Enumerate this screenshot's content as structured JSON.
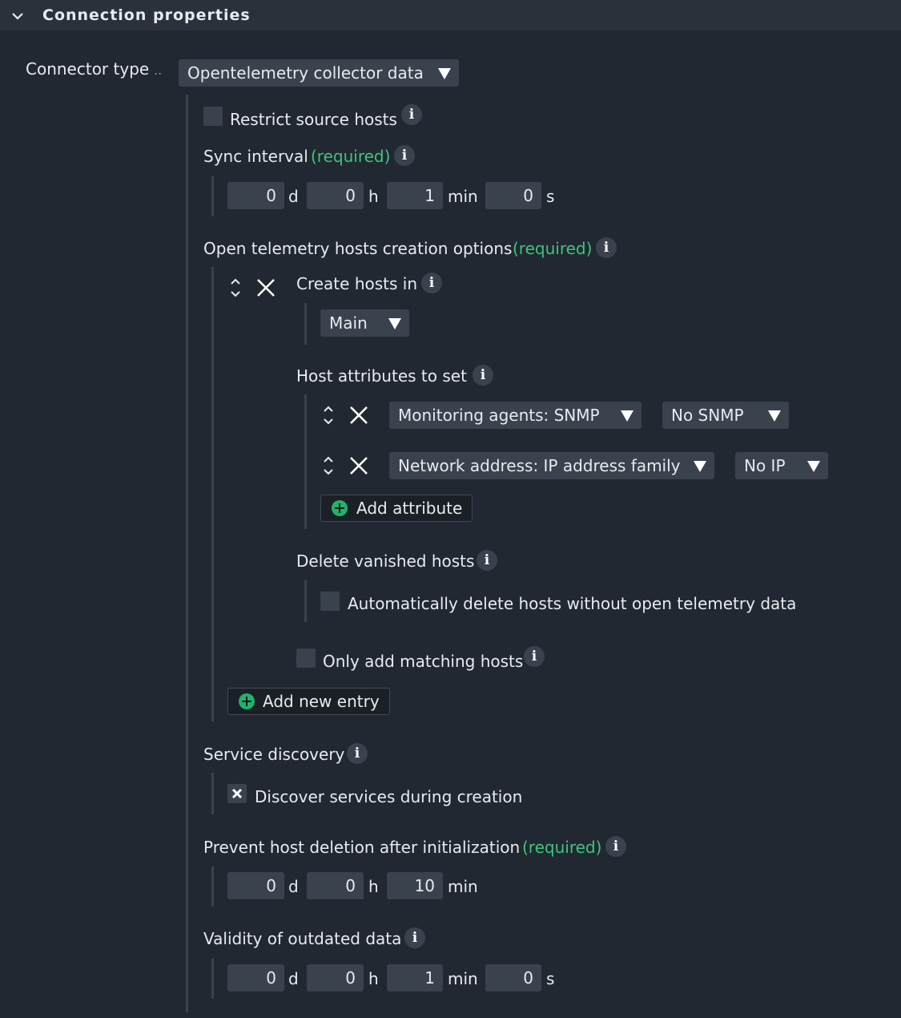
{
  "section": {
    "title": "Connection properties"
  },
  "connector": {
    "label": "Connector type",
    "dots": "..",
    "value": "Opentelemetry collector data"
  },
  "restrict": {
    "label": "Restrict source hosts"
  },
  "required_tag": "(required)",
  "sync": {
    "label": "Sync interval",
    "d": "0",
    "h": "0",
    "min": "1",
    "s": "0"
  },
  "units": {
    "d": "d",
    "h": "h",
    "min": "min",
    "s": "s"
  },
  "otel": {
    "label": "Open telemetry hosts creation options",
    "create_in": {
      "label": "Create hosts in",
      "value": "Main"
    },
    "host_attrs": {
      "label": "Host attributes to set",
      "rows": [
        {
          "attribute": "Monitoring agents: SNMP",
          "value": "No SNMP"
        },
        {
          "attribute": "Network address: IP address family",
          "value": "No IP"
        }
      ],
      "add_label": "Add attribute"
    },
    "delete_vanished": {
      "label": "Delete vanished hosts",
      "checkbox_label": "Automatically delete hosts without open telemetry data"
    },
    "only_matching": {
      "label": "Only add matching hosts"
    },
    "add_entry_label": "Add new entry"
  },
  "discovery": {
    "label": "Service discovery",
    "checkbox_label": "Discover services during creation",
    "checked": true
  },
  "prevent_deletion": {
    "label": "Prevent host deletion after initialization",
    "d": "0",
    "h": "0",
    "min": "10"
  },
  "validity": {
    "label": "Validity of outdated data",
    "d": "0",
    "h": "0",
    "min": "1",
    "s": "0"
  }
}
